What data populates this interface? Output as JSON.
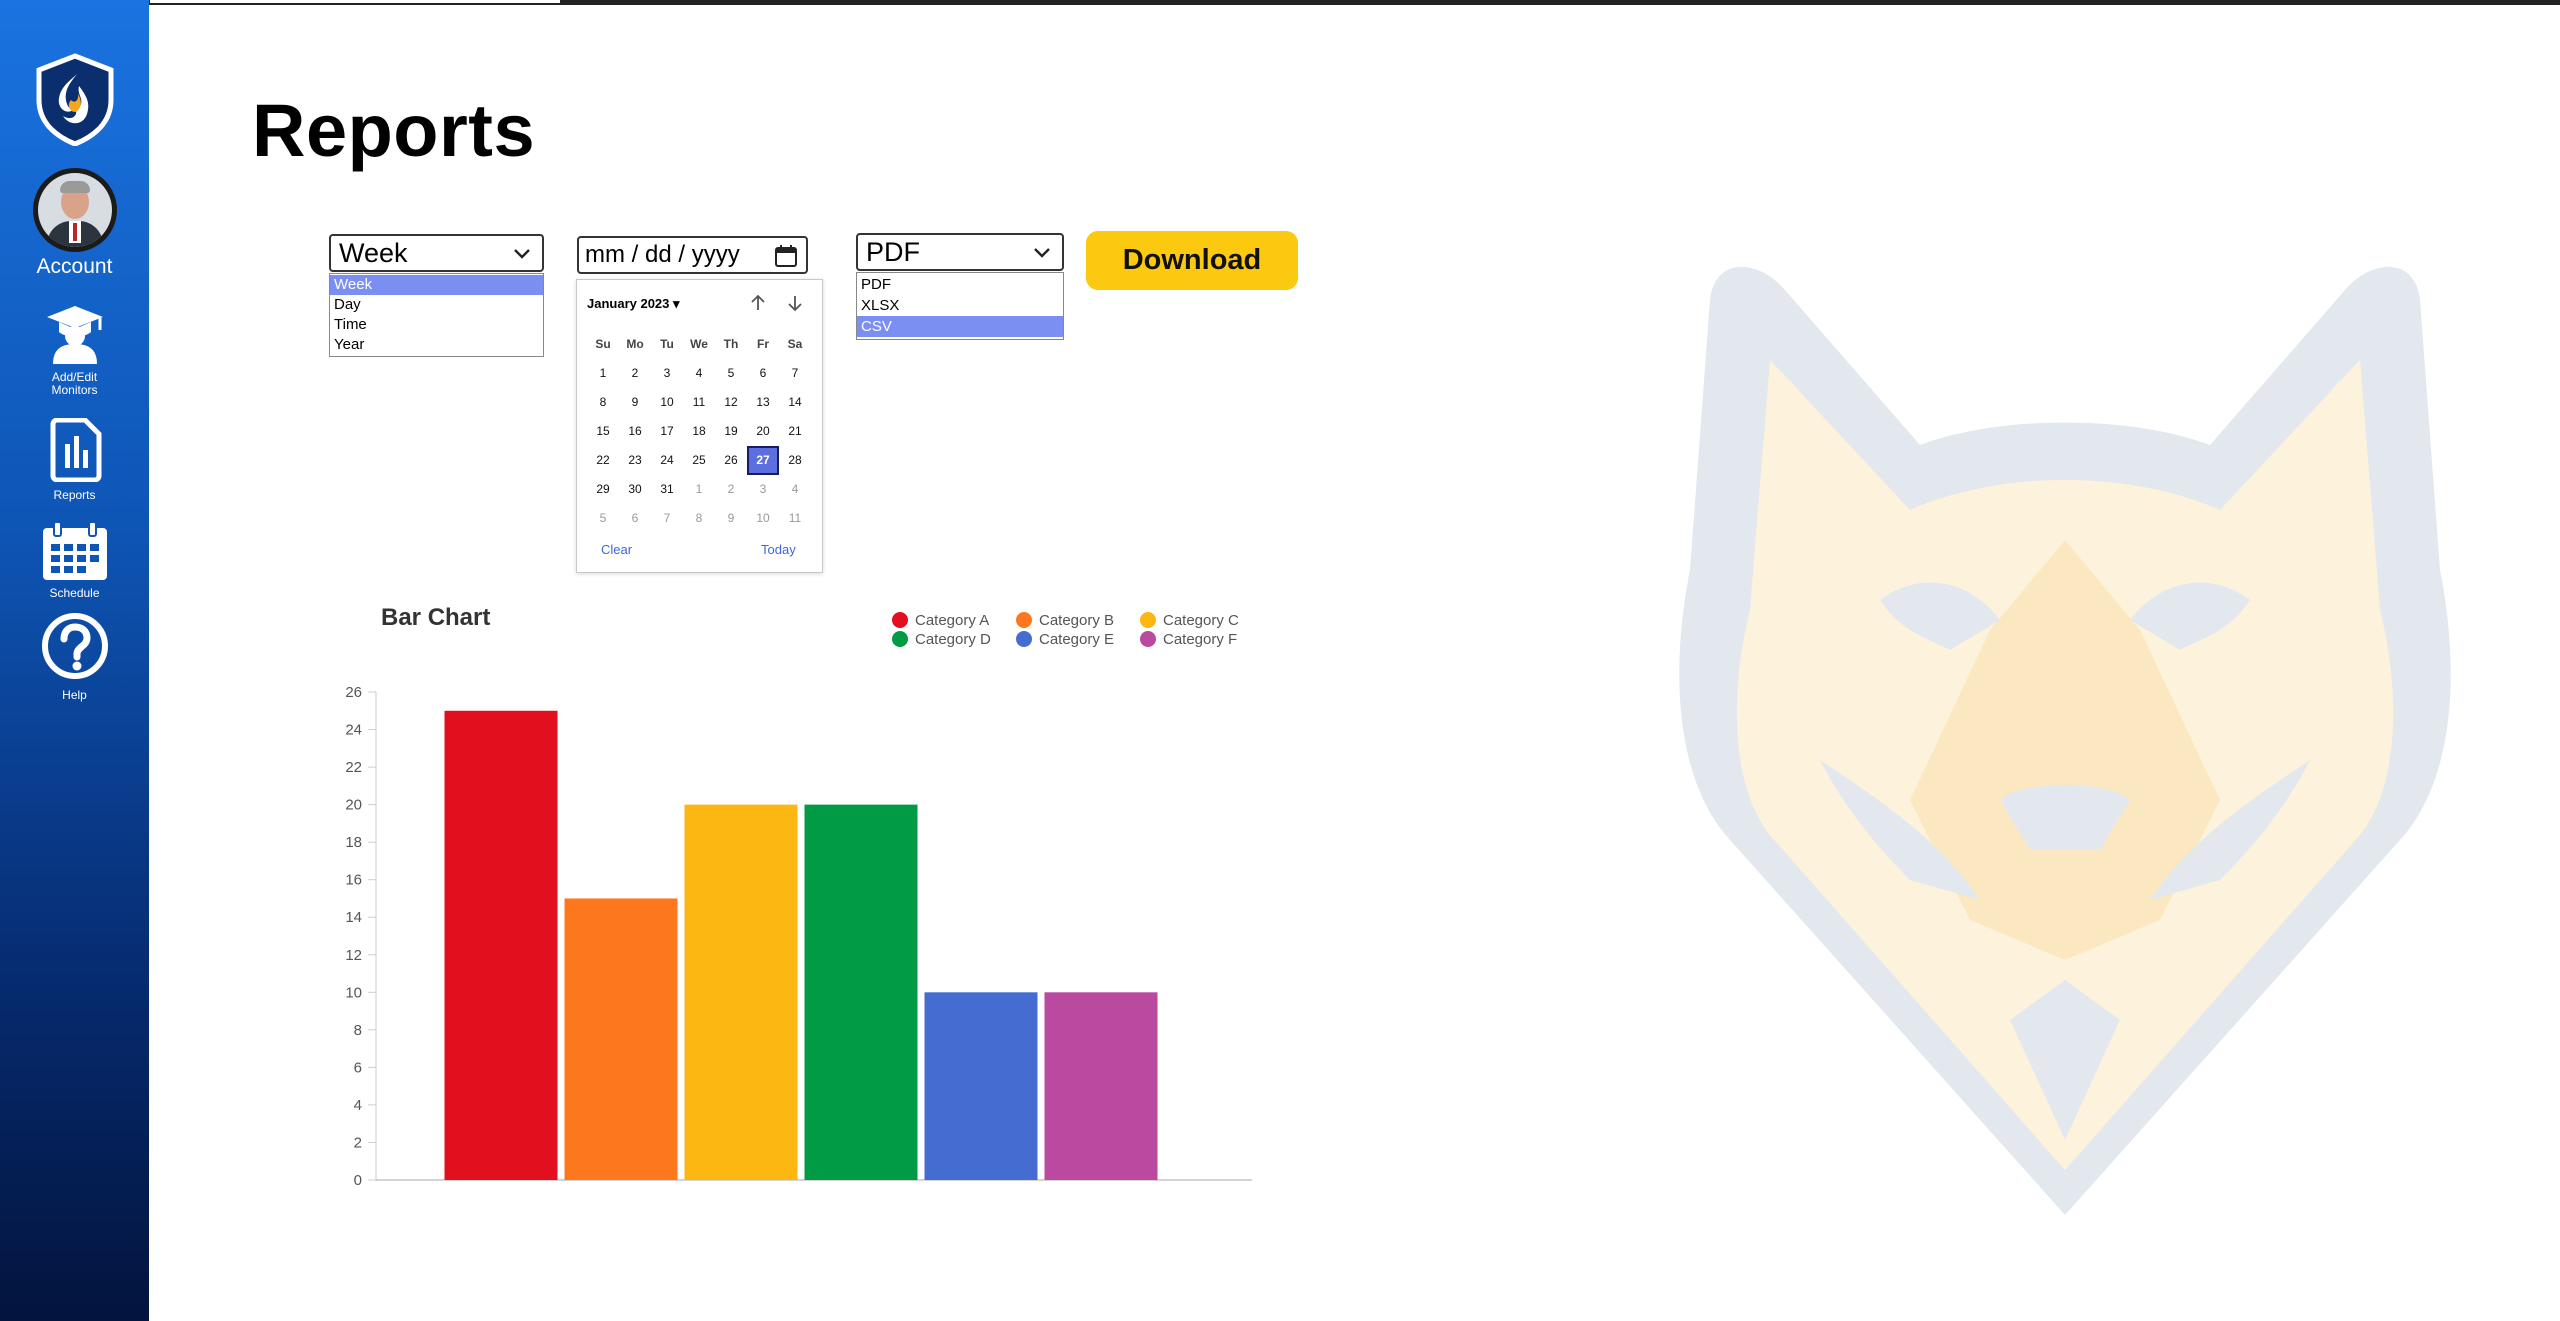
{
  "sidebar": {
    "items": [
      {
        "label": "Account",
        "icon": "avatar"
      },
      {
        "label": "Add/Edit Monitors",
        "icon": "graduate-user-icon"
      },
      {
        "label": "Reports",
        "icon": "reports-icon"
      },
      {
        "label": "Schedule",
        "icon": "calendar-icon"
      },
      {
        "label": "Help",
        "icon": "help-icon"
      }
    ],
    "logo_icon": "shield-flame-logo"
  },
  "page": {
    "title": "Reports"
  },
  "period_select": {
    "value": "Week",
    "options": [
      "Week",
      "Day",
      "Time",
      "Year"
    ],
    "selected_index": 0
  },
  "date_input": {
    "placeholder": "mm / dd / yyyy",
    "calendar": {
      "month_label": "January 2023 ▾",
      "weekdays": [
        "Su",
        "Mo",
        "Tu",
        "We",
        "Th",
        "Fr",
        "Sa"
      ],
      "weeks": [
        [
          "1",
          "2",
          "3",
          "4",
          "5",
          "6",
          "7"
        ],
        [
          "8",
          "9",
          "10",
          "11",
          "12",
          "13",
          "14"
        ],
        [
          "15",
          "16",
          "17",
          "18",
          "19",
          "20",
          "21"
        ],
        [
          "22",
          "23",
          "24",
          "25",
          "26",
          "27",
          "28"
        ],
        [
          "29",
          "30",
          "31",
          "1",
          "2",
          "3",
          "4"
        ],
        [
          "5",
          "6",
          "7",
          "8",
          "9",
          "10",
          "11"
        ]
      ],
      "selected_day": "27",
      "clear_label": "Clear",
      "today_label": "Today"
    }
  },
  "format_select": {
    "value": "PDF",
    "options": [
      "PDF",
      "XLSX",
      "CSV"
    ],
    "highlighted_index": 2
  },
  "download_button": {
    "label": "Download",
    "color": "#fbc90f"
  },
  "chart_data": {
    "type": "bar",
    "title": "Bar Chart",
    "categories": [
      "Category A",
      "Category B",
      "Category C",
      "Category D",
      "Category E",
      "Category F"
    ],
    "values": [
      25,
      15,
      20,
      20,
      10,
      10
    ],
    "colors": [
      "#e20f1e",
      "#fd771d",
      "#fdb713",
      "#009b44",
      "#456cd0",
      "#b94a9f"
    ],
    "ylim": [
      0,
      26
    ],
    "yticks": [
      0,
      2,
      4,
      6,
      8,
      10,
      12,
      14,
      16,
      18,
      20,
      22,
      24,
      26
    ],
    "legend_position": "top-right",
    "grid": false
  },
  "theme": {
    "sidebar_top": "#1a73e0",
    "sidebar_bottom": "#03143d",
    "accent": "#fbc90f"
  }
}
